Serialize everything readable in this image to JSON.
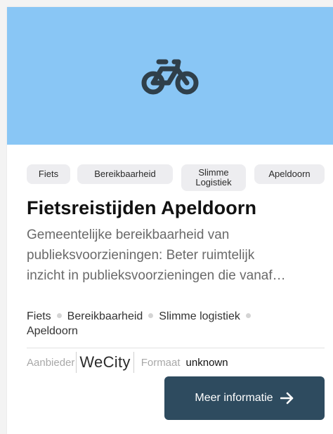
{
  "card": {
    "hero_icon": "bicycle-icon",
    "hero_color": "#89c6f5",
    "tags": [
      "Fiets",
      "Bereikbaarheid",
      "Slimme Logistiek",
      "Apeldoorn"
    ],
    "title": "Fietsreistijden Apeldoorn",
    "description_lines": [
      "Gemeentelijke bereikbaarheid van",
      "publieksvoorzieningen: Beter ruimtelijk",
      "inzicht in publieksvoorzieningen die vanaf…"
    ],
    "keywords": [
      "Fiets",
      "Bereikbaarheid",
      "Slimme logistiek",
      "Apeldoorn"
    ],
    "provider_label": "Aanbieder",
    "provider_logo_text": "WeCity",
    "format_label": "Formaat",
    "format_value": "unknown",
    "more_button_label": "Meer informatie",
    "more_button_icon": "arrow-right-icon",
    "button_color": "#2e4b5f"
  }
}
